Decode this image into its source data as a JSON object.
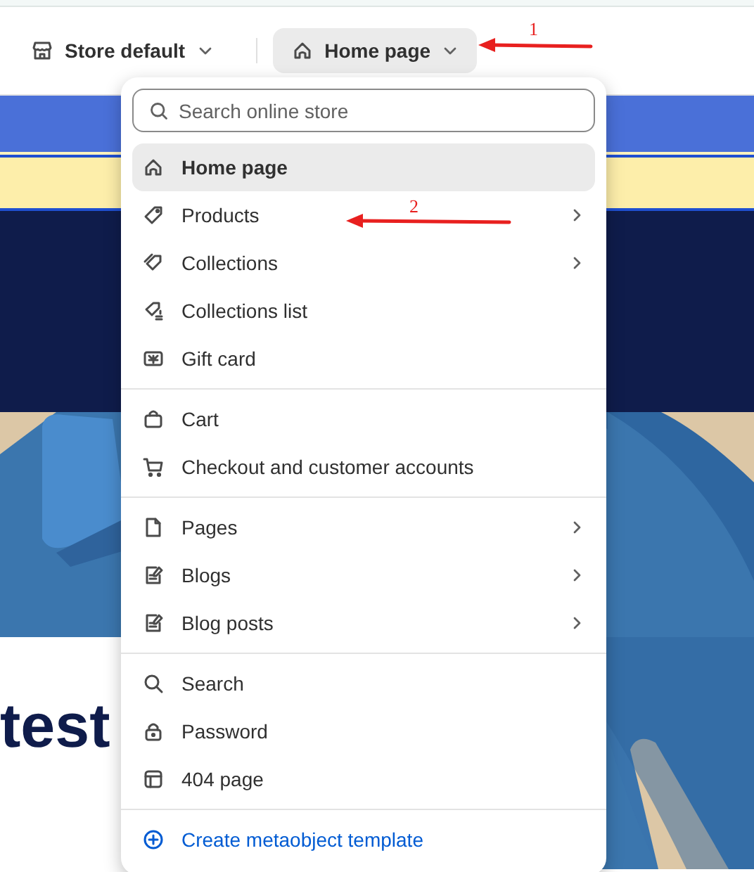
{
  "toolbar": {
    "store_selector": {
      "label": "Store default"
    },
    "page_selector": {
      "label": "Home page",
      "expanded": true
    }
  },
  "preview": {
    "headline": "test"
  },
  "menu": {
    "search": {
      "placeholder": "Search online store"
    },
    "groups": [
      {
        "items": [
          {
            "label": "Home page",
            "kind": "home",
            "selected": true,
            "submenu": false
          },
          {
            "label": "Products",
            "kind": "tag",
            "selected": false,
            "submenu": true
          },
          {
            "label": "Collections",
            "kind": "tags",
            "selected": false,
            "submenu": true
          },
          {
            "label": "Collections list",
            "kind": "taglist",
            "selected": false,
            "submenu": false
          },
          {
            "label": "Gift card",
            "kind": "gift",
            "selected": false,
            "submenu": false
          }
        ]
      },
      {
        "items": [
          {
            "label": "Cart",
            "kind": "bag",
            "selected": false,
            "submenu": false
          },
          {
            "label": "Checkout and customer accounts",
            "kind": "cart",
            "selected": false,
            "submenu": false
          }
        ]
      },
      {
        "items": [
          {
            "label": "Pages",
            "kind": "page",
            "selected": false,
            "submenu": true
          },
          {
            "label": "Blogs",
            "kind": "note",
            "selected": false,
            "submenu": true
          },
          {
            "label": "Blog posts",
            "kind": "note",
            "selected": false,
            "submenu": true
          }
        ]
      },
      {
        "items": [
          {
            "label": "Search",
            "kind": "search",
            "selected": false,
            "submenu": false
          },
          {
            "label": "Password",
            "kind": "lock",
            "selected": false,
            "submenu": false
          },
          {
            "label": "404 page",
            "kind": "layout",
            "selected": false,
            "submenu": false
          }
        ]
      }
    ],
    "footer_action": {
      "label": "Create metaobject template"
    }
  },
  "annotations": [
    {
      "label": "1"
    },
    {
      "label": "2"
    }
  ]
}
